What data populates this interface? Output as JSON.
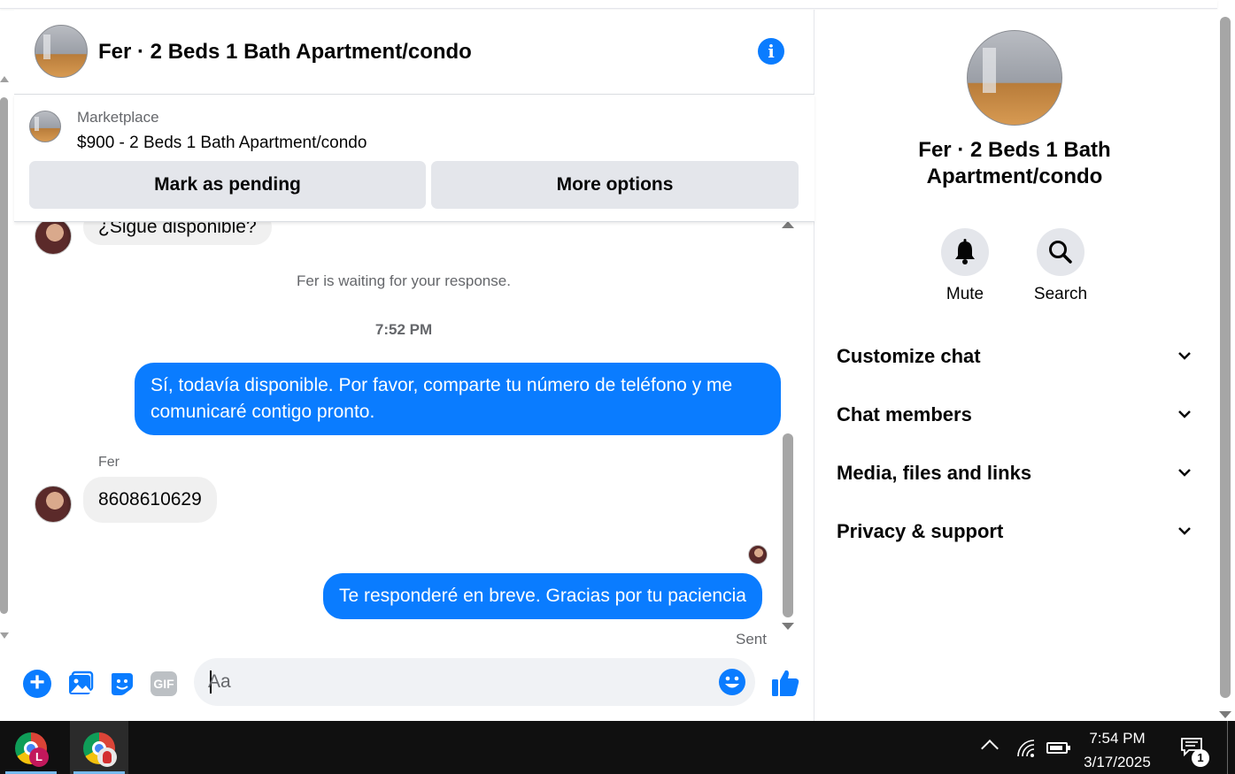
{
  "header": {
    "title": "Fer · 2 Beds 1 Bath Apartment/condo"
  },
  "marketplace": {
    "label": "Marketplace",
    "item": "$900 - 2 Beds 1 Bath Apartment/condo",
    "mark_pending_label": "Mark as pending",
    "more_options_label": "More options"
  },
  "messages": {
    "partial_bubble": "¿Sigue disponible?",
    "waiting_notice": "Fer is waiting for your response.",
    "timestamp": "7:52 PM",
    "outgoing_1": "Sí, todavía disponible. Por favor, comparte tu número de teléfono y me comunicaré contigo pronto.",
    "sender_name": "Fer",
    "incoming_1": "8608610629",
    "outgoing_2": "Te responderé en breve. Gracias por tu paciencia",
    "status": "Sent"
  },
  "composer": {
    "placeholder": "Aa",
    "gif_label": "GIF"
  },
  "details": {
    "title": "Fer · 2 Beds 1 Bath Apartment/condo",
    "mute_label": "Mute",
    "search_label": "Search",
    "sections": [
      {
        "label": "Customize chat"
      },
      {
        "label": "Chat members"
      },
      {
        "label": "Media, files and links"
      },
      {
        "label": "Privacy & support"
      }
    ]
  },
  "taskbar": {
    "profile_badge": "L",
    "time": "7:54 PM",
    "date": "3/17/2025",
    "notification_count": "1"
  },
  "colors": {
    "accent": "#0a7cff",
    "bubble_in": "#f0f0f0",
    "button_bg": "#e4e6eb",
    "taskbar": "#101010"
  }
}
